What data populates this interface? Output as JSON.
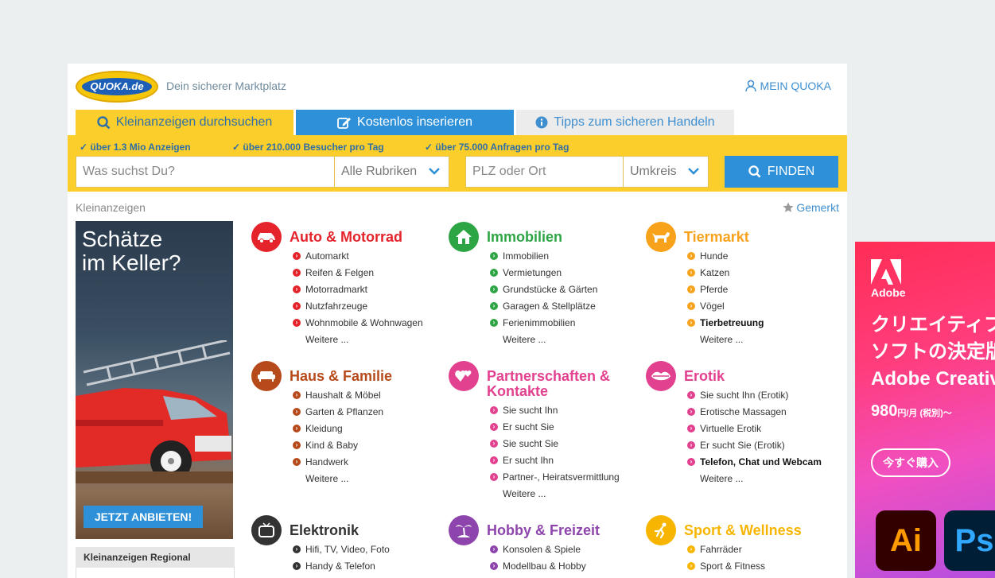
{
  "header": {
    "logo_text": "QUOKA.de",
    "tagline": "Dein sicherer Marktplatz",
    "account_label": "MEIN QUOKA"
  },
  "tabs": [
    {
      "label": "Kleinanzeigen durchsuchen"
    },
    {
      "label": "Kostenlos inserieren"
    },
    {
      "label": "Tipps zum sicheren Handeln"
    }
  ],
  "search": {
    "usps": [
      "✓ über 1.3 Mio Anzeigen",
      "✓ über 210.000 Besucher pro Tag",
      "✓ über 75.000 Anfragen pro Tag"
    ],
    "query_placeholder": "Was suchst Du?",
    "category_select": "Alle Rubriken",
    "location_placeholder": "PLZ oder Ort",
    "radius_select": "Umkreis",
    "find_label": "FINDEN"
  },
  "breadcrumb": "Kleinanzeigen",
  "saved_label": "Gemerkt",
  "left_ad": {
    "headline_1": "Schätze",
    "headline_2": "im Keller?",
    "cta": "JETZT ANBIETEN!"
  },
  "regional_label": "Kleinanzeigen Regional",
  "categories": [
    {
      "title": "Auto & Motorrad",
      "color": "#e4232b",
      "icon": "car-icon",
      "items": [
        "Automarkt",
        "Reifen & Felgen",
        "Motorradmarkt",
        "Nutzfahrzeuge",
        "Wohnmobile & Wohnwagen"
      ],
      "more": "Weitere ..."
    },
    {
      "title": "Immobilien",
      "color": "#2ea545",
      "icon": "house-icon",
      "items": [
        "Immobilien",
        "Vermietungen",
        "Grundstücke & Gärten",
        "Garagen & Stellplätze",
        "Ferienimmobilien"
      ],
      "more": "Weitere ..."
    },
    {
      "title": "Tiermarkt",
      "color": "#f7a21a",
      "icon": "dog-icon",
      "items": [
        "Hunde",
        "Katzen",
        "Pferde",
        "Vögel",
        "Tierbetreuung"
      ],
      "more": "Weitere ..."
    },
    {
      "title": "Haus & Familie",
      "color": "#b74a1a",
      "icon": "sofa-icon",
      "items": [
        "Haushalt & Möbel",
        "Garten & Pflanzen",
        "Kleidung",
        "Kind & Baby",
        "Handwerk"
      ],
      "more": "Weitere ..."
    },
    {
      "title": "Partnerschaften & Kontakte",
      "color": "#e2418f",
      "icon": "hearts-icon",
      "items": [
        "Sie sucht Ihn",
        "Er sucht Sie",
        "Sie sucht Sie",
        "Er sucht Ihn",
        "Partner-, Heiratsvermittlung"
      ],
      "more": "Weitere ..."
    },
    {
      "title": "Erotik",
      "color": "#e2418f",
      "icon": "lips-icon",
      "items": [
        "Sie sucht Ihn (Erotik)",
        "Erotische Massagen",
        "Virtuelle Erotik",
        "Er sucht Sie (Erotik)",
        "Telefon, Chat und Webcam"
      ],
      "more": "Weitere ..."
    },
    {
      "title": "Elektronik",
      "color": "#333333",
      "icon": "tv-icon",
      "items": [
        "Hifi, TV, Video, Foto",
        "Handy & Telefon"
      ],
      "more": ""
    },
    {
      "title": "Hobby & Freizeit",
      "color": "#8e44ad",
      "icon": "palm-tree-icon",
      "items": [
        "Konsolen & Spiele",
        "Modellbau & Hobby"
      ],
      "more": ""
    },
    {
      "title": "Sport & Wellness",
      "color": "#f7b500",
      "icon": "sport-icon",
      "items": [
        "Fahrräder",
        "Sport & Fitness"
      ],
      "more": ""
    }
  ],
  "right_ad": {
    "brand": "Adobe",
    "line1": "クリエイティブ",
    "line2": "ソフトの決定版",
    "line3": "Adobe Creative",
    "price": "980",
    "price_unit": "円/月 (税別)～",
    "cta": "今すぐ購入",
    "app1": "Ai",
    "app2": "Ps"
  }
}
